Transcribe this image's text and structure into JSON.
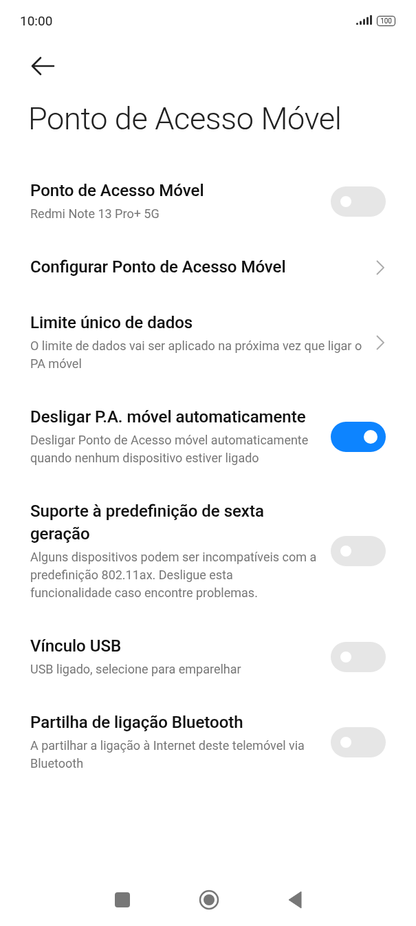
{
  "status_bar": {
    "time": "10:00",
    "battery": "100"
  },
  "title": "Ponto de Acesso Móvel",
  "items": [
    {
      "kind": "toggle",
      "title": "Ponto de Acesso Móvel",
      "subtitle": "Redmi Note 13 Pro+ 5G",
      "on": false
    },
    {
      "kind": "link",
      "title": "Configurar Ponto de Acesso Móvel"
    },
    {
      "kind": "link",
      "title": "Limite único de dados",
      "subtitle": "O limite de dados vai ser aplicado na próxima vez que ligar o PA móvel"
    },
    {
      "kind": "toggle",
      "title": "Desligar P.A. móvel automaticamente",
      "subtitle": "Desligar Ponto de Acesso móvel automaticamente quando nenhum dispositivo estiver ligado",
      "on": true
    },
    {
      "kind": "toggle",
      "title": "Suporte à predefinição de sexta geração",
      "subtitle": "Alguns dispositivos podem ser incompatíveis com a predefinição 802.11ax. Desligue esta funcionalidade caso encontre problemas.",
      "on": false
    },
    {
      "kind": "toggle",
      "title": "Vínculo USB",
      "subtitle": "USB ligado, selecione para emparelhar",
      "on": false
    },
    {
      "kind": "toggle",
      "title": "Partilha de ligação Bluetooth",
      "subtitle": "A partilhar a ligação à Internet deste telemóvel via Bluetooth",
      "on": false
    }
  ]
}
